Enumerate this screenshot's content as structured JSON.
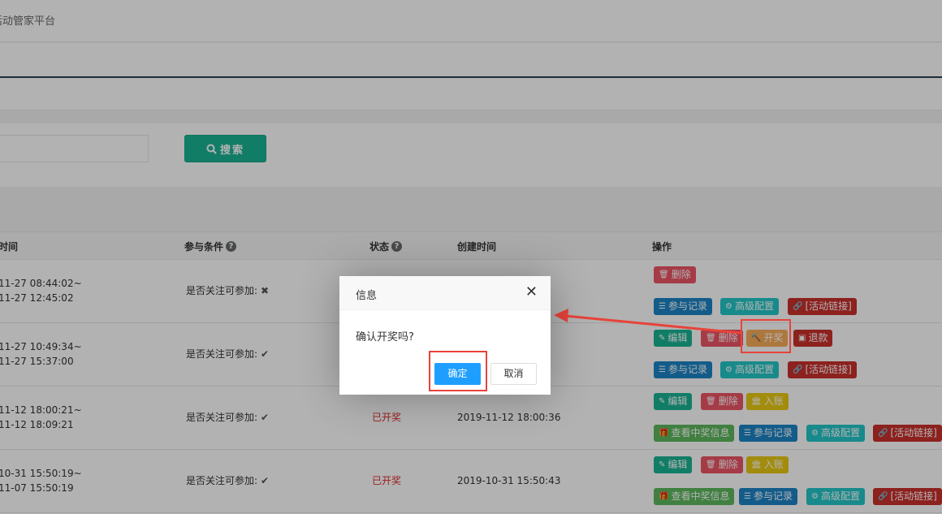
{
  "header": {
    "title": "活动管家平台"
  },
  "search": {
    "button_label": "搜索",
    "input_value": ""
  },
  "table": {
    "columns": {
      "time": "时间",
      "condition": "参与条件",
      "status": "状态",
      "created": "创建时间",
      "actions": "操作"
    },
    "rows": [
      {
        "time_start": "11-27 08:44:02~",
        "time_end": "11-27 12:45:02",
        "condition": "是否关注可参加:",
        "condition_mark": "✖",
        "status": "",
        "created": ""
      },
      {
        "time_start": "11-27 10:49:34~",
        "time_end": "11-27 15:37:00",
        "condition": "是否关注可参加:",
        "condition_mark": "✔",
        "status": "",
        "created": ""
      },
      {
        "time_start": "11-12 18:00:21~",
        "time_end": "11-12 18:09:21",
        "condition": "是否关注可参加:",
        "condition_mark": "✔",
        "status": "已开奖",
        "created": "2019-11-12 18:00:36"
      },
      {
        "time_start": "10-31 15:50:19~",
        "time_end": "11-07 15:50:19",
        "condition": "是否关注可参加:",
        "condition_mark": "✔",
        "status": "已开奖",
        "created": "2019-10-31 15:50:43"
      }
    ],
    "actions": {
      "delete": "删除",
      "records": "参与记录",
      "advanced": "高级配置",
      "link": "[活动链接]",
      "edit": "编辑",
      "draw": "开奖",
      "refund": "退款",
      "account": "入账",
      "winners": "查看中奖信息"
    }
  },
  "dialog": {
    "title": "信息",
    "message": "确认开奖吗?",
    "confirm": "确定",
    "cancel": "取消"
  },
  "icons": {
    "search": "search-icon",
    "help": "help-icon",
    "close": "close-icon"
  },
  "colors": {
    "primary": "#1ab394",
    "danger": "#ed5565",
    "info": "#1c84c6",
    "teal": "#23c6c8",
    "dialog_ok": "#1e9fff",
    "highlight": "#e8433a"
  }
}
